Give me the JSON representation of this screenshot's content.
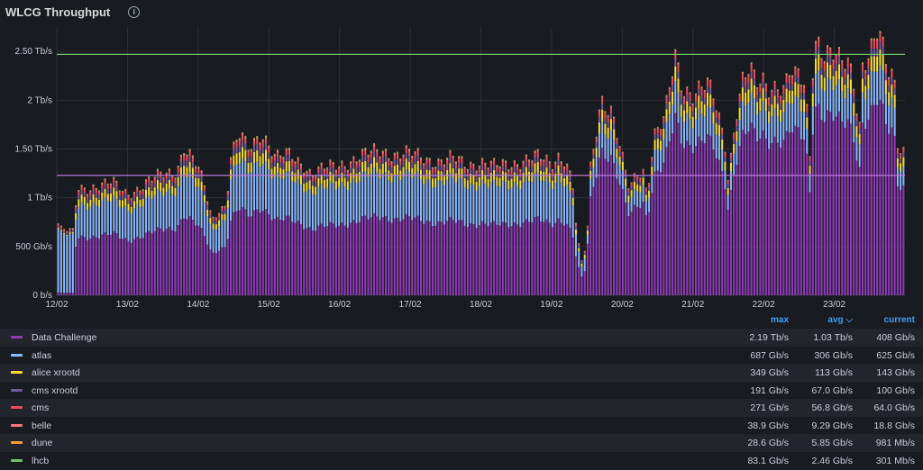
{
  "panel": {
    "title": "WLCG Throughput",
    "info_icon": "info-icon"
  },
  "chart_data": {
    "type": "bar",
    "stacked": true,
    "ylim": [
      0,
      2.75
    ],
    "y_unit": "Tb/s",
    "y_ticks": [
      {
        "value": 0,
        "label": "0 b/s"
      },
      {
        "value": 0.5,
        "label": "500 Gb/s"
      },
      {
        "value": 1,
        "label": "1 Tb/s"
      },
      {
        "value": 1.5,
        "label": "1.50 Tb/s"
      },
      {
        "value": 2,
        "label": "2 Tb/s"
      },
      {
        "value": 2.5,
        "label": "2.50 Tb/s"
      }
    ],
    "x_range": [
      0,
      12
    ],
    "x_ticks": [
      "12/02",
      "13/02",
      "14/02",
      "15/02",
      "16/02",
      "17/02",
      "18/02",
      "19/02",
      "20/02",
      "21/02",
      "22/02",
      "23/02"
    ],
    "thresholds": [
      {
        "value": 2.47,
        "color": "#73bf69"
      },
      {
        "value": 1.23,
        "color": "#b877d9"
      }
    ],
    "grid": true,
    "legend_placement": "bottom",
    "series_colors": [
      "#8f3bb8",
      "#8ab8ff",
      "#fade2a",
      "#705da0",
      "#f2495c",
      "#ff7383",
      "#ff9830",
      "#73bf69"
    ],
    "total_profile": [
      [
        0.0,
        0.78
      ],
      [
        0.05,
        0.68
      ],
      [
        0.25,
        0.65
      ],
      [
        0.28,
        1.1
      ],
      [
        0.5,
        1.12
      ],
      [
        0.8,
        1.15
      ],
      [
        1.0,
        1.05
      ],
      [
        1.2,
        1.12
      ],
      [
        1.5,
        1.25
      ],
      [
        1.7,
        1.3
      ],
      [
        1.8,
        1.52
      ],
      [
        2.0,
        1.3
      ],
      [
        2.1,
        1.1
      ],
      [
        2.2,
        0.78
      ],
      [
        2.3,
        0.9
      ],
      [
        2.4,
        0.92
      ],
      [
        2.45,
        1.4
      ],
      [
        2.6,
        1.65
      ],
      [
        2.7,
        1.5
      ],
      [
        2.8,
        1.6
      ],
      [
        2.9,
        1.7
      ],
      [
        3.1,
        1.4
      ],
      [
        3.3,
        1.45
      ],
      [
        3.5,
        1.35
      ],
      [
        3.6,
        1.25
      ],
      [
        3.8,
        1.3
      ],
      [
        4.0,
        1.35
      ],
      [
        4.2,
        1.4
      ],
      [
        4.4,
        1.45
      ],
      [
        4.6,
        1.5
      ],
      [
        4.8,
        1.45
      ],
      [
        5.0,
        1.45
      ],
      [
        5.2,
        1.42
      ],
      [
        5.4,
        1.38
      ],
      [
        5.6,
        1.4
      ],
      [
        5.8,
        1.35
      ],
      [
        6.0,
        1.38
      ],
      [
        6.2,
        1.32
      ],
      [
        6.4,
        1.35
      ],
      [
        6.6,
        1.4
      ],
      [
        6.8,
        1.42
      ],
      [
        7.0,
        1.35
      ],
      [
        7.1,
        1.45
      ],
      [
        7.2,
        1.4
      ],
      [
        7.3,
        1.15
      ],
      [
        7.35,
        0.7
      ],
      [
        7.42,
        0.32
      ],
      [
        7.5,
        0.55
      ],
      [
        7.55,
        1.3
      ],
      [
        7.7,
        2.05
      ],
      [
        7.85,
        1.9
      ],
      [
        8.0,
        1.4
      ],
      [
        8.1,
        1.08
      ],
      [
        8.2,
        1.25
      ],
      [
        8.3,
        1.3
      ],
      [
        8.35,
        1.05
      ],
      [
        8.45,
        1.65
      ],
      [
        8.6,
        1.8
      ],
      [
        8.75,
        2.45
      ],
      [
        8.85,
        2.15
      ],
      [
        9.0,
        2.1
      ],
      [
        9.2,
        2.15
      ],
      [
        9.3,
        2.0
      ],
      [
        9.45,
        1.6
      ],
      [
        9.5,
        1.2
      ],
      [
        9.6,
        1.85
      ],
      [
        9.7,
        2.2
      ],
      [
        9.8,
        2.3
      ],
      [
        9.9,
        2.15
      ],
      [
        10.0,
        2.2
      ],
      [
        10.1,
        2.15
      ],
      [
        10.2,
        2.2
      ],
      [
        10.3,
        2.1
      ],
      [
        10.35,
        2.3
      ],
      [
        10.45,
        2.2
      ],
      [
        10.5,
        2.25
      ],
      [
        10.6,
        2.1
      ],
      [
        10.65,
        1.35
      ],
      [
        10.7,
        2.45
      ],
      [
        10.75,
        2.7
      ],
      [
        10.85,
        2.5
      ],
      [
        11.0,
        2.45
      ],
      [
        11.1,
        2.35
      ],
      [
        11.2,
        2.4
      ],
      [
        11.3,
        2.15
      ],
      [
        11.35,
        1.65
      ],
      [
        11.4,
        2.4
      ],
      [
        11.55,
        2.55
      ],
      [
        11.62,
        2.7
      ],
      [
        11.75,
        2.3
      ],
      [
        11.85,
        2.25
      ],
      [
        11.9,
        1.55
      ],
      [
        12.0,
        1.5
      ],
      [
        12.05,
        1.35
      ]
    ]
  },
  "legend": {
    "headers": {
      "max": "max",
      "avg": "avg ⌵",
      "current": "current"
    },
    "rows": [
      {
        "name": "Data Challenge",
        "color": "#8f3bb8",
        "max": "2.19 Tb/s",
        "avg": "1.03 Tb/s",
        "current": "408 Gb/s"
      },
      {
        "name": "atlas",
        "color": "#8ab8ff",
        "max": "687 Gb/s",
        "avg": "306 Gb/s",
        "current": "625 Gb/s"
      },
      {
        "name": "alice xrootd",
        "color": "#fade2a",
        "max": "349 Gb/s",
        "avg": "113 Gb/s",
        "current": "143 Gb/s"
      },
      {
        "name": "cms xrootd",
        "color": "#705da0",
        "max": "191 Gb/s",
        "avg": "67.0 Gb/s",
        "current": "100 Gb/s"
      },
      {
        "name": "cms",
        "color": "#f2495c",
        "max": "271 Gb/s",
        "avg": "56.8 Gb/s",
        "current": "64.0 Gb/s"
      },
      {
        "name": "belle",
        "color": "#ff7383",
        "max": "38.9 Gb/s",
        "avg": "9.29 Gb/s",
        "current": "18.8 Gb/s"
      },
      {
        "name": "dune",
        "color": "#ff9830",
        "max": "28.6 Gb/s",
        "avg": "5.85 Gb/s",
        "current": "981 Mb/s"
      },
      {
        "name": "lhcb",
        "color": "#73bf69",
        "max": "83.1 Gb/s",
        "avg": "2.46 Gb/s",
        "current": "301 Mb/s"
      }
    ]
  }
}
